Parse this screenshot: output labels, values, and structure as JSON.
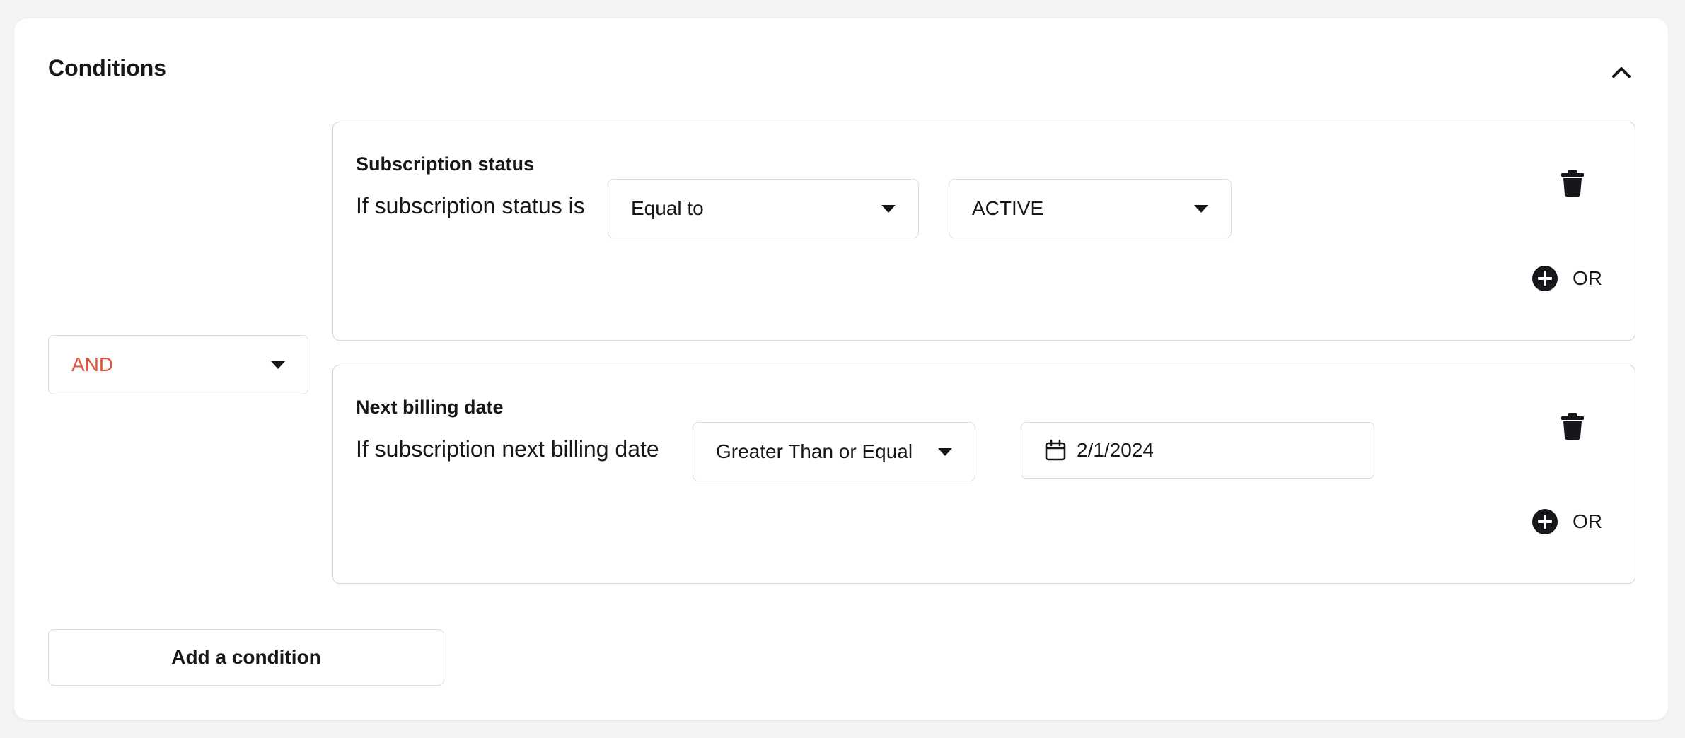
{
  "section": {
    "title": "Conditions",
    "collapse_icon": "chevron-up-icon"
  },
  "logic_operator": {
    "value": "AND",
    "color": "#e0553a"
  },
  "conditions": [
    {
      "title": "Subscription status",
      "label": "If subscription status is",
      "operator": "Equal to",
      "value": "ACTIVE",
      "or_label": "OR"
    },
    {
      "title": "Next billing date",
      "label": "If subscription next billing date",
      "operator": "Greater Than or Equal",
      "value": "2/1/2024",
      "value_icon": "calendar-icon",
      "or_label": "OR"
    }
  ],
  "add_condition_label": "Add a condition"
}
